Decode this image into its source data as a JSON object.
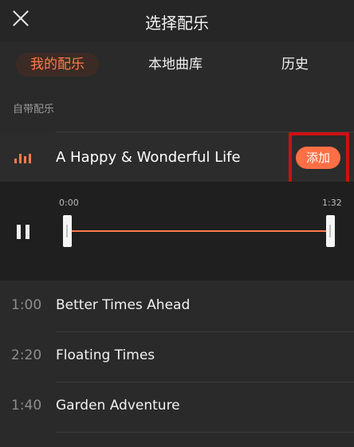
{
  "header": {
    "title": "选择配乐",
    "close_icon": "close-icon"
  },
  "tabs": [
    {
      "label": "我的配乐",
      "active": true
    },
    {
      "label": "本地曲库",
      "active": false
    },
    {
      "label": "历史",
      "active": false
    }
  ],
  "section": {
    "label": "自带配乐"
  },
  "active_track": {
    "icon": "equalizer-icon",
    "title": "A Happy & Wonderful Life",
    "add_label": "添加"
  },
  "player": {
    "icon": "pause-icon",
    "start_time": "0:00",
    "end_time": "1:32"
  },
  "songs": [
    {
      "duration": "1:00",
      "title": "Better Times Ahead"
    },
    {
      "duration": "2:20",
      "title": "Floating Times"
    },
    {
      "duration": "1:40",
      "title": "Garden Adventure"
    }
  ],
  "colors": {
    "accent": "#ff7a4c",
    "highlight_border": "#cc1111",
    "background": "#2a2a2a"
  }
}
